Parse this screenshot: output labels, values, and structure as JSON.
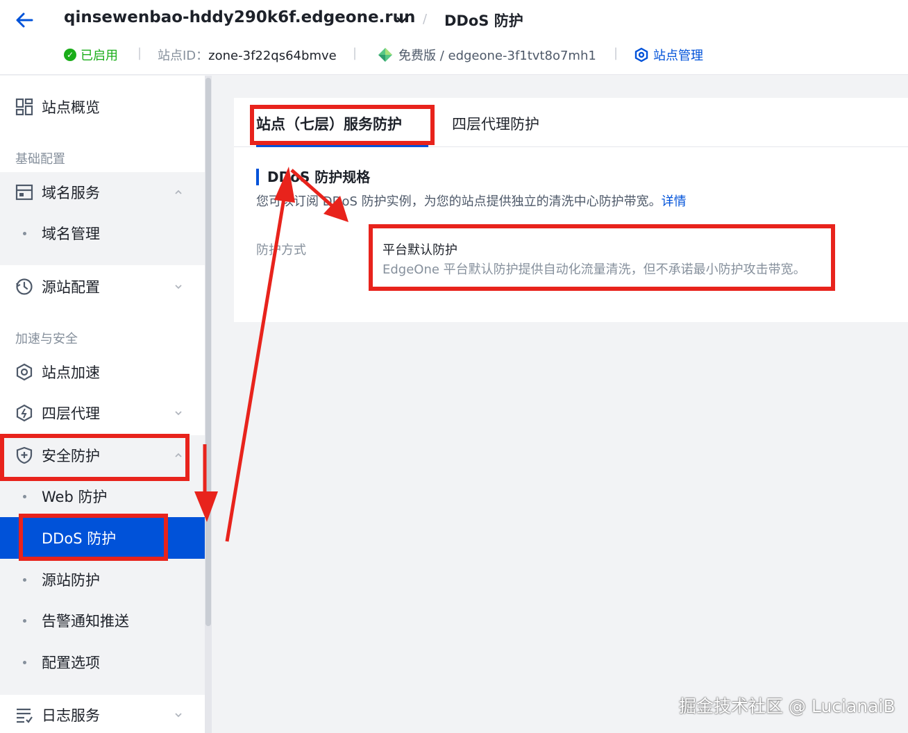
{
  "header": {
    "site_name": "qinsewenbao-hddy290k6f.edgeone.run",
    "separator": "/",
    "page_name": "DDoS 防护",
    "status": "已启用",
    "meta_separator": "|",
    "zone_label": "站点ID：",
    "zone_id": "zone-3f22qs64bmve",
    "plan": "免费版 / edgeone-3f1tvt8o7mh1",
    "manage": "站点管理"
  },
  "sidebar": {
    "overview": "站点概览",
    "group_basic": "基础配置",
    "domain_service": "域名服务",
    "domain_manage": "域名管理",
    "origin_config": "源站配置",
    "group_accel": "加速与安全",
    "site_accel": "站点加速",
    "l4_proxy": "四层代理",
    "security": "安全防护",
    "web_protect": "Web 防护",
    "ddos_protect": "DDoS 防护",
    "origin_protect": "源站防护",
    "alert_push": "告警通知推送",
    "config_options": "配置选项",
    "log_service": "日志服务"
  },
  "main": {
    "tab_l7": "站点（七层）服务防护",
    "tab_l4": "四层代理防护",
    "section_title": "DDoS 防护规格",
    "section_desc": "您可以订阅 DDoS 防护实例，为您的站点提供独立的清洗中心防护带宽。",
    "details_link": "详情",
    "mode_label": "防护方式",
    "mode_title": "平台默认防护",
    "mode_desc": "EdgeOne 平台默认防护提供自动化流量清洗，但不承诺最小防护攻击带宽。"
  },
  "watermark": "掘金技术社区 @ LucianaiB",
  "colors": {
    "accent": "#0052d9",
    "success": "#1aad19",
    "annotation": "#e8231c"
  },
  "icons": [
    "back-arrow-icon",
    "chevron-down-icon",
    "check-circle-icon",
    "gem-icon",
    "gear-hex-icon",
    "dashboard-icon",
    "domain-icon",
    "origin-icon",
    "accel-icon",
    "l4-icon",
    "shield-icon",
    "log-icon"
  ]
}
